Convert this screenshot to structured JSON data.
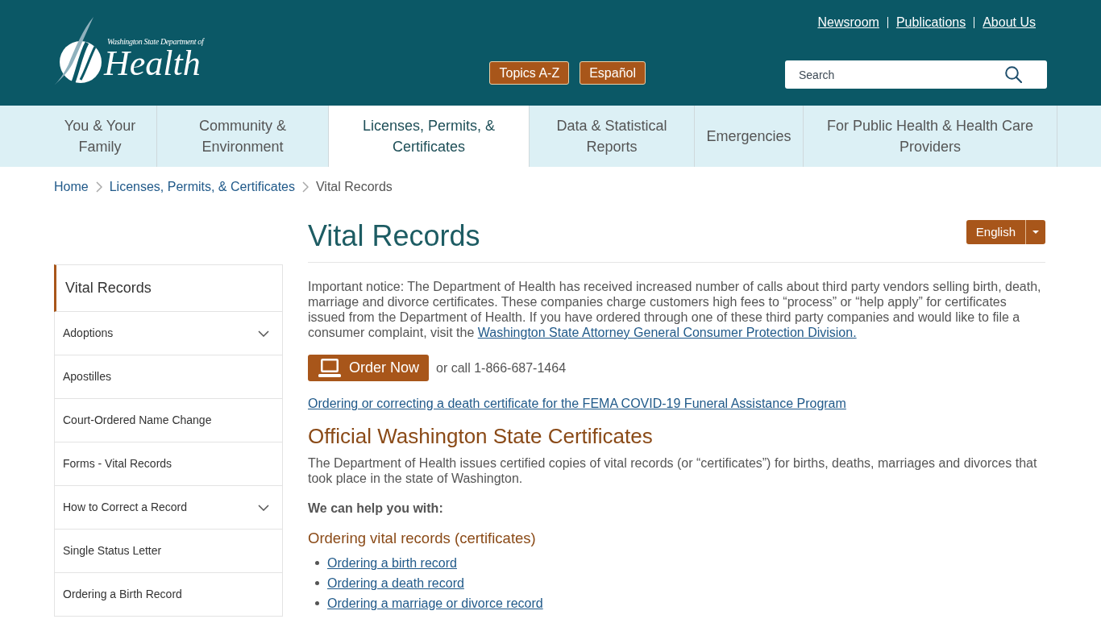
{
  "header": {
    "logo": {
      "subtitle": "Washington State Department of",
      "title": "Health"
    },
    "utility_links": [
      "Newsroom",
      "Publications",
      "About Us"
    ],
    "buttons": [
      "Topics A-Z",
      "Español"
    ],
    "search": {
      "placeholder": "Search"
    }
  },
  "main_nav": [
    {
      "label": "You & Your Family",
      "selected": false
    },
    {
      "label": "Community & Environment",
      "selected": false
    },
    {
      "label": "Licenses, Permits, & Certificates",
      "selected": true
    },
    {
      "label": "Data & Statistical Reports",
      "selected": false
    },
    {
      "label": "Emergencies",
      "selected": false
    },
    {
      "label": "For Public Health & Health Care Providers",
      "selected": false
    }
  ],
  "breadcrumb": [
    {
      "label": "Home",
      "kind": "link"
    },
    {
      "label": "Licenses, Permits, & Certificates",
      "kind": "link"
    },
    {
      "label": "Vital Records",
      "kind": "current"
    }
  ],
  "sidebar": {
    "title": "Vital Records",
    "items": [
      {
        "label": "Adoptions",
        "kind": "expandable"
      },
      {
        "label": "Apostilles",
        "kind": "link"
      },
      {
        "label": "Court-Ordered Name Change",
        "kind": "link"
      },
      {
        "label": "Forms - Vital Records",
        "kind": "link"
      },
      {
        "label": "How to Correct a Record",
        "kind": "expandable"
      },
      {
        "label": "Single Status Letter",
        "kind": "link"
      },
      {
        "label": "Ordering a Birth Record",
        "kind": "link"
      }
    ]
  },
  "content": {
    "title": "Vital Records",
    "language_button": "English",
    "notice": {
      "text": "Important notice: The Department of Health has received increased number of calls about third party vendors selling birth, death, marriage and divorce certificates. These companies charge customers high fees to “process” or “help apply” for certificates issued from the Department of Health. If you have ordered through one of these third party companies and would like to file a consumer complaint, visit the",
      "link": "Washington State Attorney General Consumer Protection Division."
    },
    "order_button": "Order Now",
    "phone_text": "or call 1-866-687-1464",
    "fema_link": "Ordering or correcting a death certificate for the FEMA COVID-19 Funeral Assistance Program",
    "section_heading": "Official Washington State Certificates",
    "section_text": "The Department of Health issues certified copies of vital records (or “certificates”) for births, deaths, marriages and divorces that took place in the state of Washington.",
    "help_label": "We can help you with:",
    "subheading": "Ordering vital records (certificates)",
    "links": [
      "Ordering a birth record",
      "Ordering a death record",
      "Ordering a marriage or divorce record"
    ]
  }
}
